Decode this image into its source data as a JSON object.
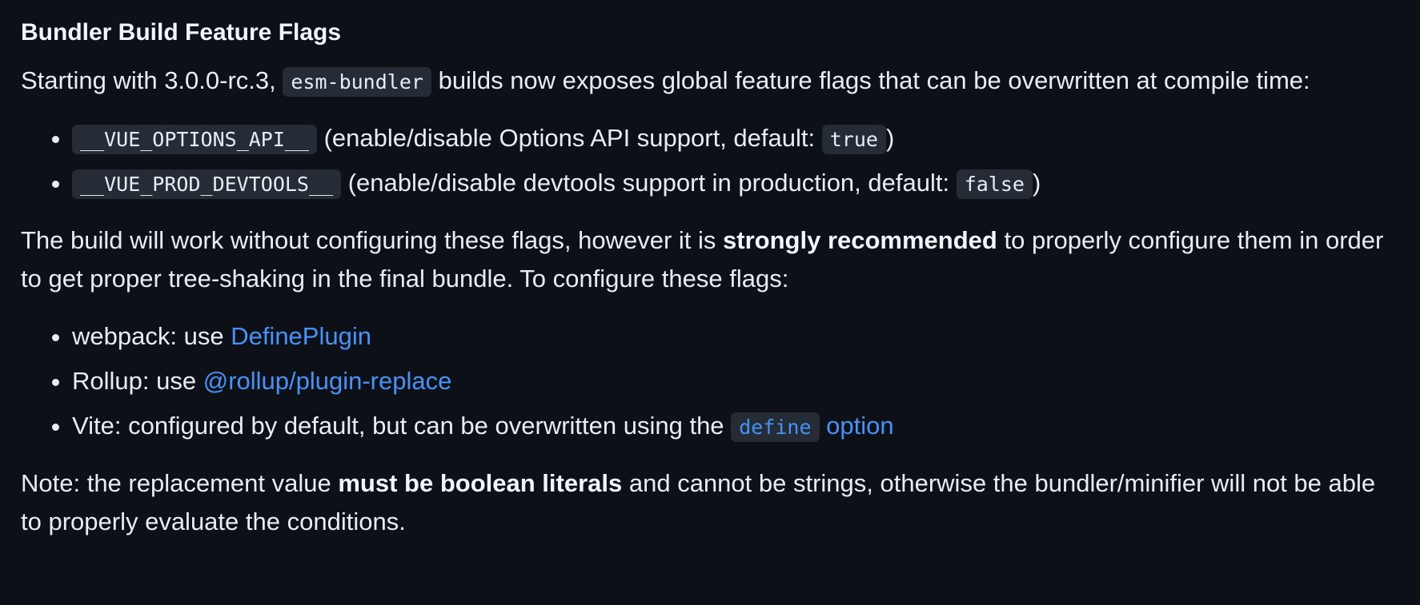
{
  "heading": "Bundler Build Feature Flags",
  "intro": {
    "before": "Starting with 3.0.0-rc.3,",
    "code": "esm-bundler",
    "after": "builds now exposes global feature flags that can be overwritten at compile time:"
  },
  "flags": [
    {
      "name": "__VUE_OPTIONS_API__",
      "description": "(enable/disable Options API support, default:",
      "default": "true",
      "close": ")"
    },
    {
      "name": "__VUE_PROD_DEVTOOLS__",
      "description": "(enable/disable devtools support in production, default:",
      "default": "false",
      "close": ")"
    }
  ],
  "recommendation": {
    "before": "The build will work without configuring these flags, however it is",
    "bold": "strongly recommended",
    "after": "to properly configure them in order to get proper tree-shaking in the final bundle. To configure these flags:"
  },
  "tools": {
    "webpack": {
      "prefix": "webpack: use",
      "link": "DefinePlugin"
    },
    "rollup": {
      "prefix": "Rollup: use",
      "link": "@rollup/plugin-replace"
    },
    "vite": {
      "prefix": "Vite: configured by default, but can be overwritten using the",
      "link_code": "define",
      "link_text": "option"
    }
  },
  "note": {
    "before": "Note: the replacement value",
    "bold": "must be boolean literals",
    "after": "and cannot be strings, otherwise the bundler/minifier will not be able to properly evaluate the conditions."
  },
  "colors": {
    "background": "#0d1117",
    "text": "#e6edf3",
    "link": "#4493f8",
    "code_background": "#262c36"
  }
}
